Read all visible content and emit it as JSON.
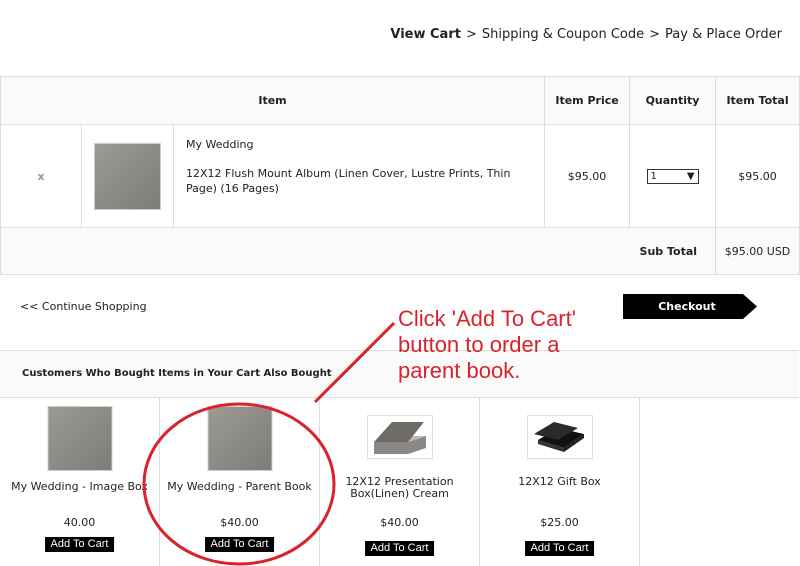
{
  "breadcrumb": {
    "step1": "View Cart",
    "sep": ">",
    "step2": "Shipping & Coupon Code",
    "step3": "Pay & Place Order"
  },
  "cart": {
    "headers": {
      "item": "Item",
      "price": "Item Price",
      "quantity": "Quantity",
      "total": "Item Total"
    },
    "item": {
      "remove": "x",
      "name": "My Wedding",
      "description": "12X12 Flush Mount Album (Linen Cover, Lustre Prints, Thin Page) (16 Pages)",
      "price": "$95.00",
      "quantity": "1",
      "total": "$95.00"
    },
    "subtotal_label": "Sub Total",
    "subtotal_value": "$95.00 USD"
  },
  "continue_shopping": "<< Continue Shopping",
  "checkout_label": "Checkout",
  "also_bought": {
    "heading": "Customers Who Bought Items in Your Cart Also Bought",
    "products": [
      {
        "title": "My Wedding - Image Box",
        "price": "40.00",
        "button": "Add To Cart",
        "icon": "album-thumbnail"
      },
      {
        "title": "My Wedding - Parent Book",
        "price": "$40.00",
        "button": "Add To Cart",
        "icon": "album-thumbnail"
      },
      {
        "title": "12X12 Presentation Box(Linen) Cream",
        "price": "$40.00",
        "button": "Add To Cart",
        "icon": "open-box-image"
      },
      {
        "title": "12X12 Gift Box",
        "price": "$25.00",
        "button": "Add To Cart",
        "icon": "black-box-image"
      }
    ]
  },
  "annotation": {
    "line1": "Click 'Add To Cart'",
    "line2": "button to order a",
    "line3": "parent book.",
    "color": "#d8232a"
  },
  "colors": {
    "checkout_bg": "#000000",
    "border": "#dddddd"
  }
}
